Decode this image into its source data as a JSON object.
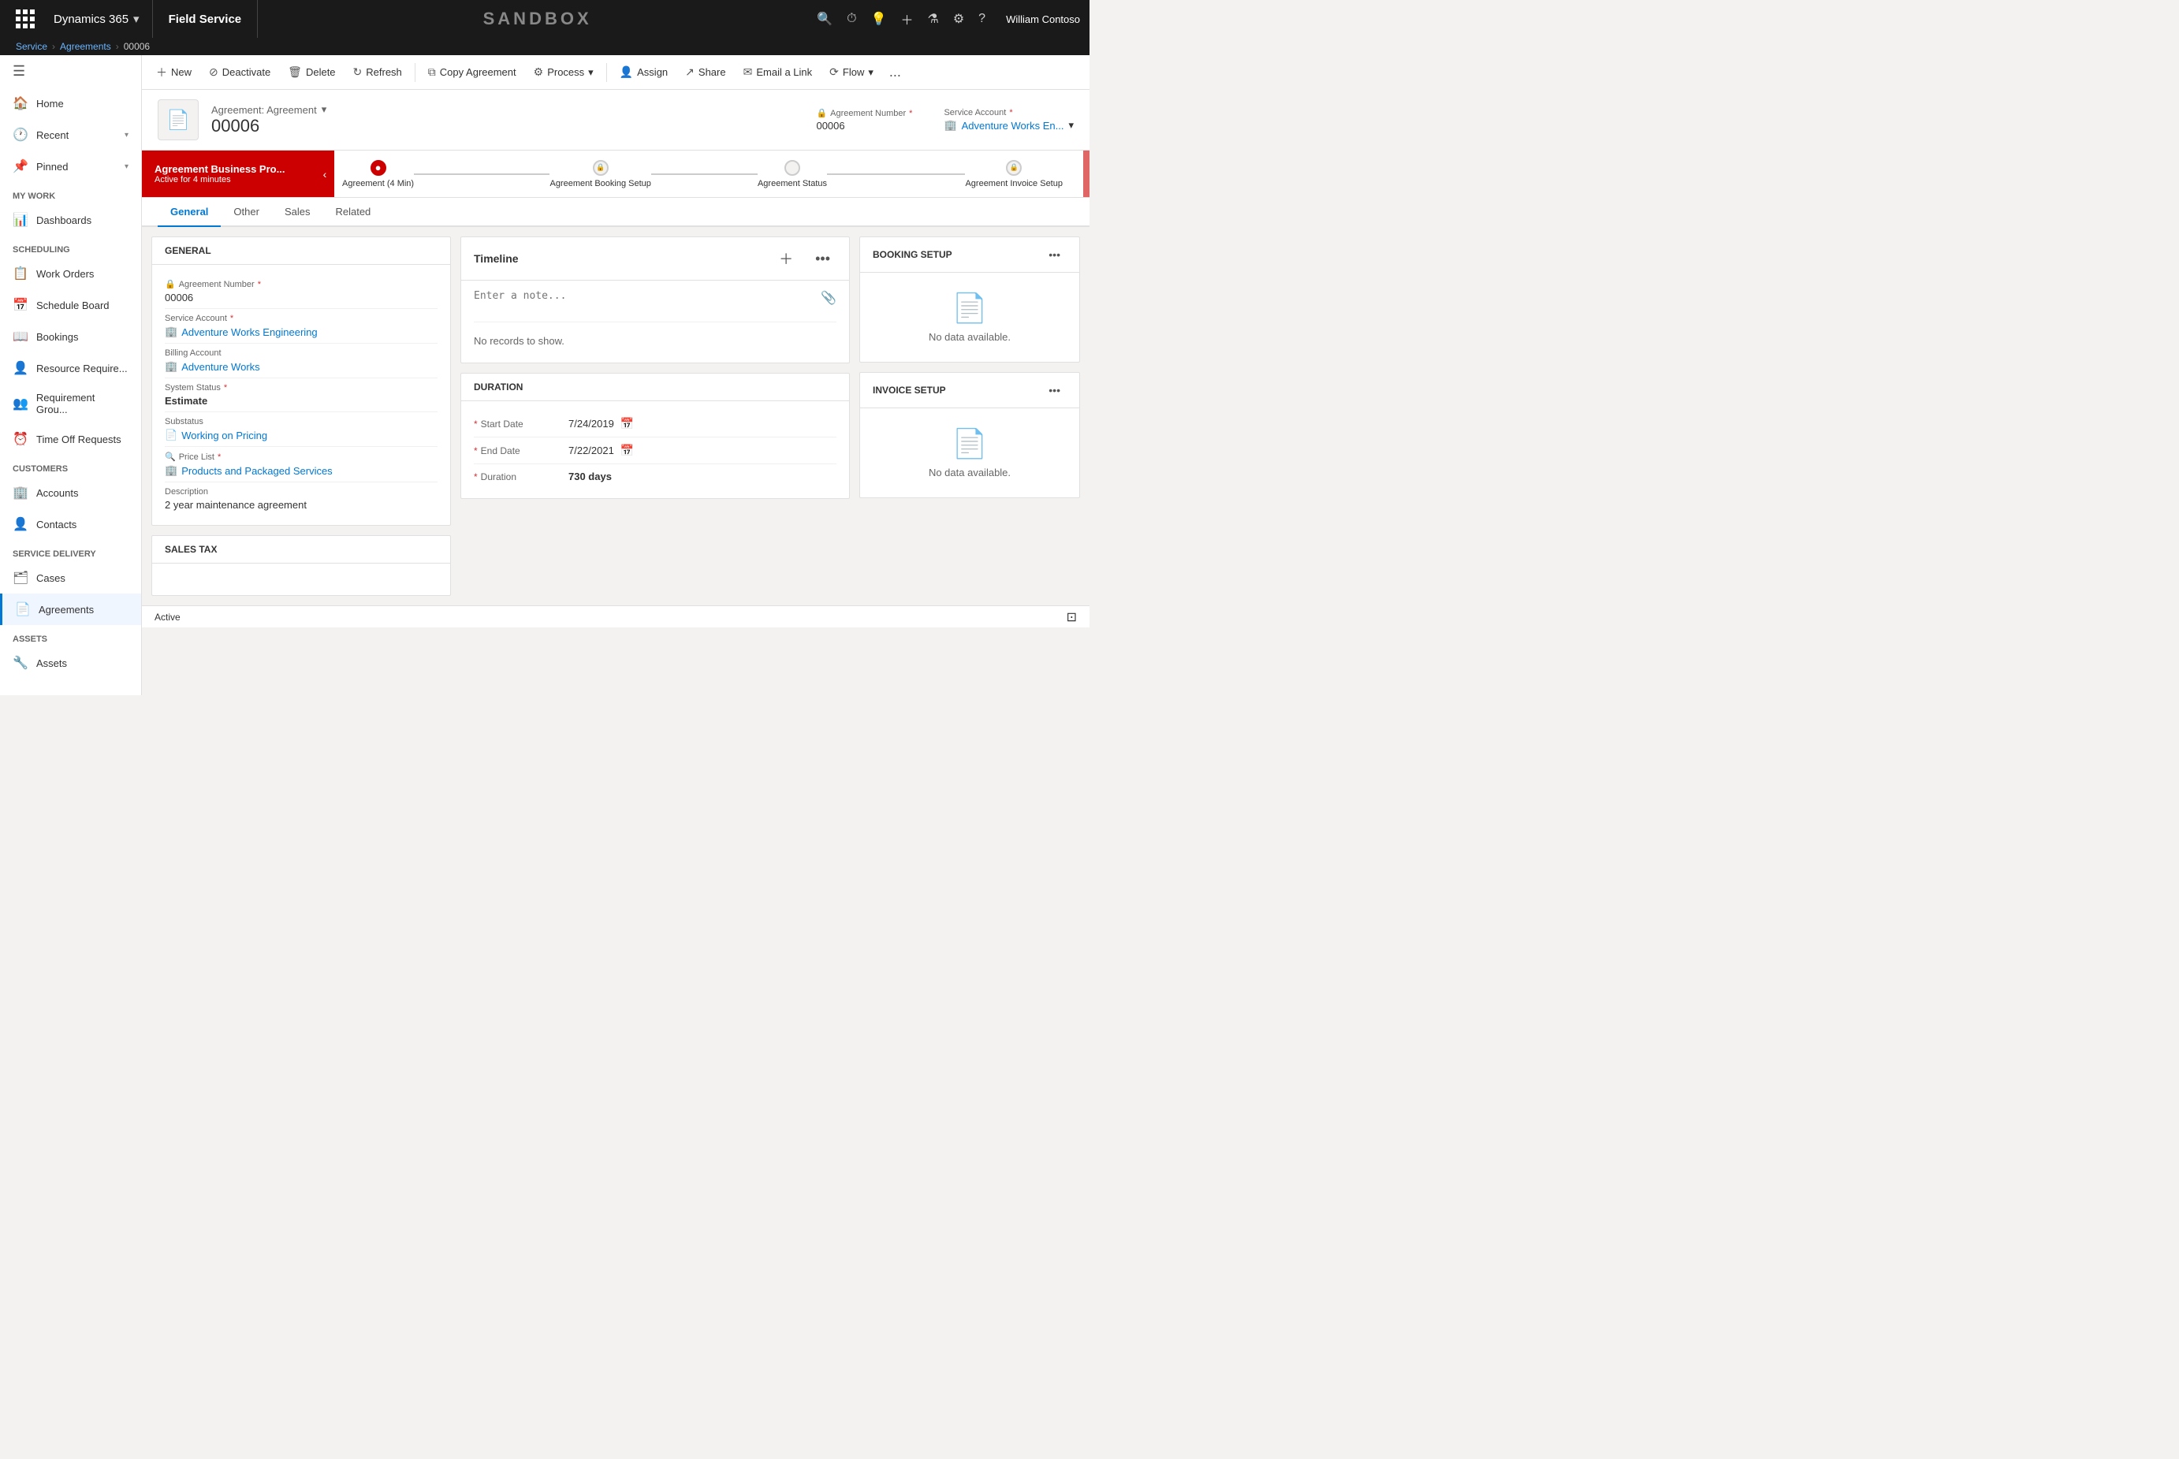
{
  "topnav": {
    "app": "Dynamics 365",
    "module": "Field Service",
    "sandbox_label": "SANDBOX",
    "user": "William Contoso"
  },
  "breadcrumb": {
    "service": "Service",
    "agreements": "Agreements",
    "record": "00006",
    "sep": ">"
  },
  "toolbar": {
    "new": "New",
    "deactivate": "Deactivate",
    "delete": "Delete",
    "refresh": "Refresh",
    "copy_agreement": "Copy Agreement",
    "process": "Process",
    "assign": "Assign",
    "share": "Share",
    "email_link": "Email a Link",
    "flow": "Flow",
    "more": "..."
  },
  "record": {
    "entity": "Agreement: Agreement",
    "number": "00006",
    "agreement_number_label": "Agreement Number",
    "agreement_number_value": "00006",
    "service_account_label": "Service Account",
    "service_account_value": "Adventure Works En..."
  },
  "process_bar": {
    "active_stage": "Agreement Business Pro...",
    "active_status": "Active for 4 minutes",
    "stages": [
      {
        "label": "Agreement  (4 Min)",
        "active": true,
        "locked": false
      },
      {
        "label": "Agreement Booking Setup",
        "active": false,
        "locked": true
      },
      {
        "label": "Agreement Status",
        "active": false,
        "locked": true
      },
      {
        "label": "Agreement Invoice Setup",
        "active": false,
        "locked": true
      }
    ]
  },
  "tabs": [
    {
      "label": "General",
      "active": true
    },
    {
      "label": "Other",
      "active": false
    },
    {
      "label": "Sales",
      "active": false
    },
    {
      "label": "Related",
      "active": false
    }
  ],
  "general_section": {
    "title": "GENERAL",
    "fields": [
      {
        "label": "Agreement Number",
        "value": "00006",
        "required": true,
        "locked": true
      },
      {
        "label": "Service Account",
        "value": "Adventure Works Engineering",
        "link": true,
        "required": true
      },
      {
        "label": "Billing Account",
        "value": "Adventure Works",
        "link": true
      },
      {
        "label": "System Status",
        "value": "Estimate",
        "required": true,
        "bold": true
      },
      {
        "label": "Substatus",
        "value": "Working on Pricing",
        "link": true
      },
      {
        "label": "Price List",
        "value": "Products and Packaged Services",
        "link": true,
        "required": true
      },
      {
        "label": "Description",
        "value": "2 year maintenance agreement"
      }
    ]
  },
  "sales_tax_section": {
    "title": "SALES TAX"
  },
  "timeline": {
    "title": "Timeline",
    "note_placeholder": "Enter a note...",
    "empty_text": "No records to show."
  },
  "duration": {
    "title": "DURATION",
    "start_date_label": "Start Date",
    "start_date_value": "7/24/2019",
    "end_date_label": "End Date",
    "end_date_value": "7/22/2021",
    "duration_label": "Duration",
    "duration_value": "730 days"
  },
  "booking_setup": {
    "title": "BOOKING SETUP",
    "no_data": "No data available."
  },
  "invoice_setup": {
    "title": "INVOICE SETUP",
    "no_data": "No data available."
  },
  "sidebar": {
    "hamburger": "≡",
    "nav": [
      {
        "label": "Home",
        "icon": "🏠",
        "section": null
      },
      {
        "label": "Recent",
        "icon": "🕐",
        "expand": true
      },
      {
        "label": "Pinned",
        "icon": "📌",
        "expand": true
      }
    ],
    "sections": [
      {
        "header": "My Work",
        "items": [
          {
            "label": "Dashboards",
            "icon": "📊"
          }
        ]
      },
      {
        "header": "Scheduling",
        "items": [
          {
            "label": "Work Orders",
            "icon": "📋"
          },
          {
            "label": "Schedule Board",
            "icon": "📅"
          },
          {
            "label": "Bookings",
            "icon": "📖"
          },
          {
            "label": "Resource Require...",
            "icon": "👤"
          },
          {
            "label": "Requirement Grou...",
            "icon": "👥"
          },
          {
            "label": "Time Off Requests",
            "icon": "⏰"
          }
        ]
      },
      {
        "header": "Customers",
        "items": [
          {
            "label": "Accounts",
            "icon": "🏢"
          },
          {
            "label": "Contacts",
            "icon": "👤"
          }
        ]
      },
      {
        "header": "Service Delivery",
        "items": [
          {
            "label": "Cases",
            "icon": "🗂"
          },
          {
            "label": "Agreements",
            "icon": "📄",
            "active": true
          }
        ]
      },
      {
        "header": "Assets",
        "items": [
          {
            "label": "Assets",
            "icon": "🔧"
          }
        ]
      }
    ]
  },
  "status_bar": {
    "status": "Active"
  }
}
